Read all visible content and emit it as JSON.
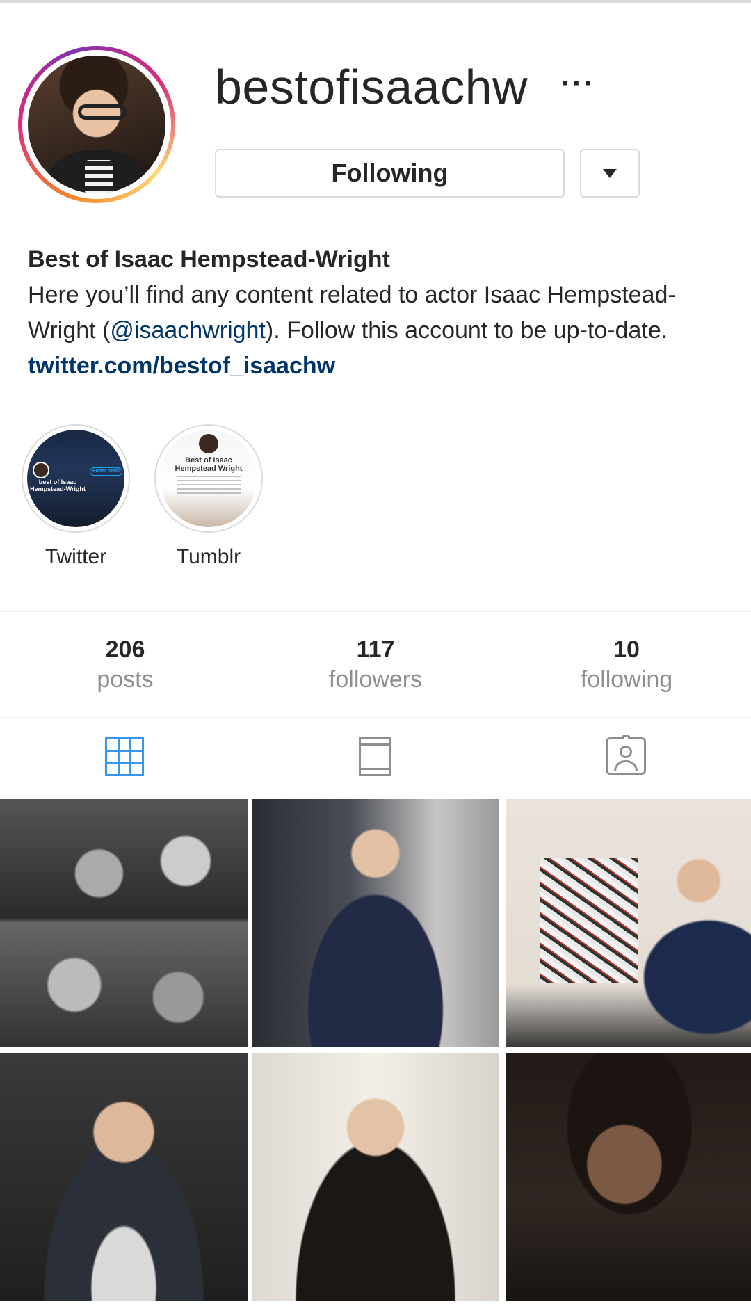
{
  "profile": {
    "username": "bestofisaachw",
    "more_icon": "more-horizontal-icon",
    "following_button": "Following",
    "dropdown_icon": "caret-down-icon"
  },
  "bio": {
    "name": "Best of Isaac Hempstead-Wright",
    "text_before": "Here you’ll find any content related to actor Isaac Hempstead-Wright (",
    "mention": "@isaachwright",
    "text_after": "). Follow this account to be up-to-date.",
    "link": "twitter.com/bestof_isaachw"
  },
  "highlights": [
    {
      "label": "Twitter",
      "mini_name": "best of Isaac Hempstead-Wright",
      "mini_button": "Editar perfil"
    },
    {
      "label": "Tumblr",
      "mini_title": "Best of Isaac Hempstead Wright"
    }
  ],
  "stats": {
    "posts": {
      "count": "206",
      "label": "posts"
    },
    "followers": {
      "count": "117",
      "label": "followers"
    },
    "following": {
      "count": "10",
      "label": "following"
    }
  },
  "tabs": [
    {
      "icon": "grid-icon",
      "active": true
    },
    {
      "icon": "feed-icon",
      "active": false
    },
    {
      "icon": "tagged-icon",
      "active": false
    }
  ],
  "colors": {
    "link": "#003569",
    "active_tab": "#3897f0",
    "muted": "#8e8e8e",
    "border": "#dbdbdb"
  }
}
